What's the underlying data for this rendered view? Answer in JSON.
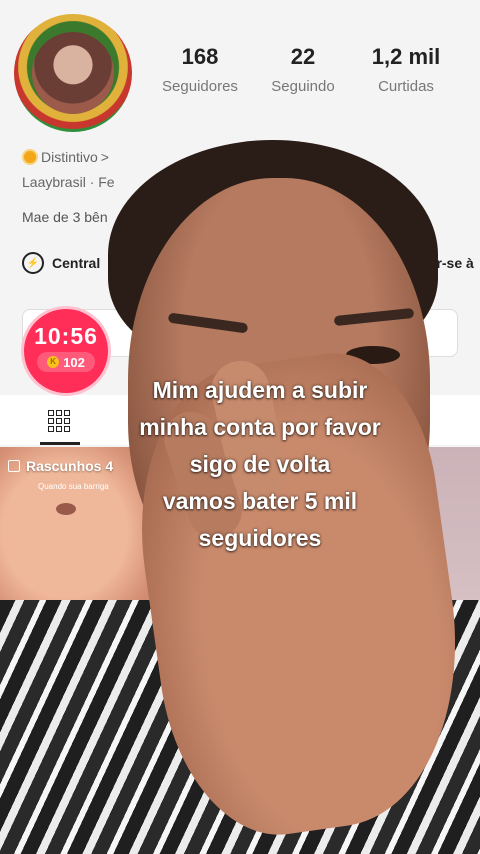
{
  "profile": {
    "stats": [
      {
        "value": "168",
        "label": "Seguidores"
      },
      {
        "value": "22",
        "label": "Seguindo"
      },
      {
        "value": "1,2 mil",
        "label": "Curtidas"
      }
    ],
    "badge_label": "Distintivo",
    "badge_chevron": ">",
    "meta_text": "Laaybrasil · Fe",
    "bio": "Mae de 3 bên",
    "central_label": "Central",
    "join_text": "tar-se à"
  },
  "timer": {
    "time": "10:56",
    "coins": "102",
    "coin_symbol": "K"
  },
  "drafts": {
    "label": "Rascunhos 4",
    "caption": "Quando sua barriga"
  },
  "overlay": {
    "lines": [
      "Mim ajudem a subir",
      "minha conta por favor",
      "sigo de volta",
      "vamos bater 5 mil",
      "seguidores"
    ]
  },
  "colors": {
    "timer_bg": "#ff2e58",
    "badge_gold": "#f2a618"
  }
}
